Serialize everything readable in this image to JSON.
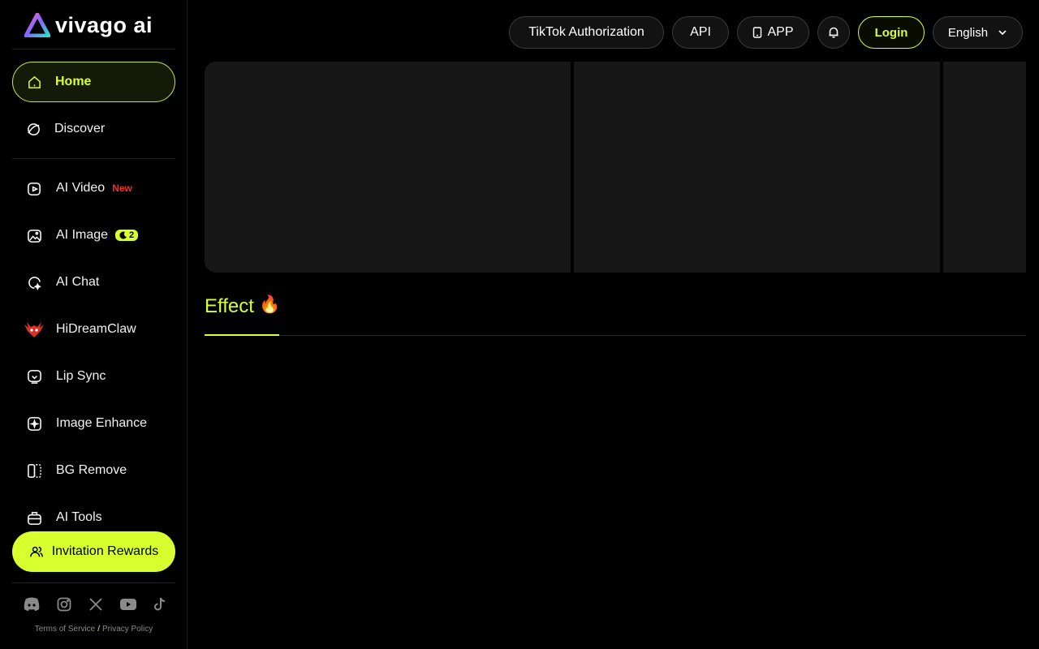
{
  "app": {
    "logo_text": "vivago ai"
  },
  "sidebar": {
    "home": "Home",
    "discover": "Discover",
    "tools": [
      {
        "label": "AI Video",
        "badge": "New",
        "icon": "video-sparkle-icon"
      },
      {
        "label": "AI Image",
        "badge": "2",
        "icon": "image-icon"
      },
      {
        "label": "AI Chat",
        "icon": "chat-sparkle-icon"
      },
      {
        "label": "HiDreamClaw",
        "icon": "claw-avatar-icon"
      },
      {
        "label": "Lip Sync",
        "icon": "lip-sync-icon"
      },
      {
        "label": "Image Enhance",
        "icon": "enhance-icon"
      },
      {
        "label": "BG Remove",
        "icon": "bg-remove-icon"
      },
      {
        "label": "AI Tools",
        "icon": "toolbox-icon"
      }
    ],
    "invite": "Invitation Rewards",
    "socials": [
      "discord-icon",
      "instagram-icon",
      "x-icon",
      "youtube-icon",
      "tiktok-icon"
    ],
    "terms": "Terms of Service",
    "slash": "/",
    "privacy": "Privacy Policy"
  },
  "header": {
    "tiktok": "TikTok Authorization",
    "api": "API",
    "app": "APP",
    "login": "Login",
    "language": "English"
  },
  "main": {
    "tab_label": "Effect",
    "tab_emoji": "🔥"
  },
  "colors": {
    "accent": "#d8ff2e",
    "new_badge": "#ff2a2a",
    "card_bg": "#171717"
  }
}
